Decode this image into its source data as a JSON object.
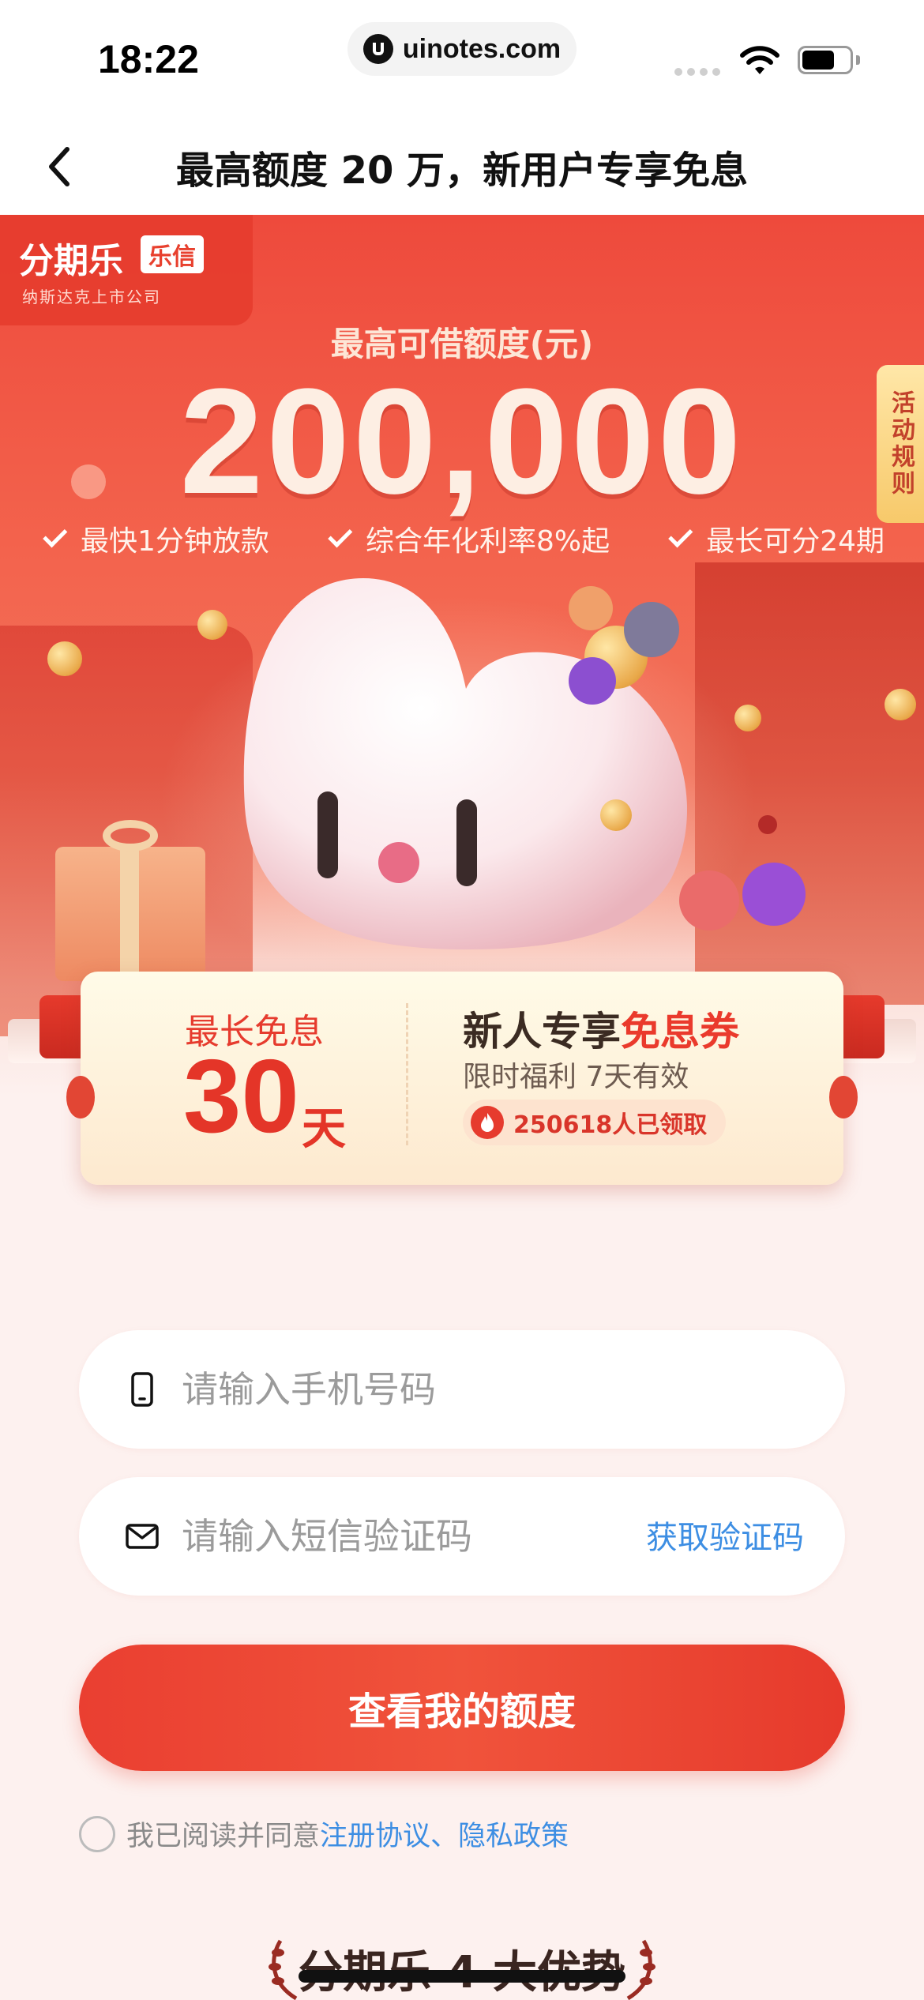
{
  "status_bar": {
    "time": "18:22",
    "url": "uinotes.com"
  },
  "nav": {
    "title": "最高额度 20 万，新用户专享免息"
  },
  "hero": {
    "brand": "分期乐",
    "brand_tag": "乐信",
    "brand_sub": "纳斯达克上市公司",
    "amount_label": "最高可借额度(元)",
    "amount": "200,000",
    "rules_tab": "活动规则",
    "features": [
      "最快1分钟放款",
      "综合年化利率8%起",
      "最长可分24期"
    ]
  },
  "coupon": {
    "left_title": "最长免息",
    "days": "30",
    "days_unit": "天",
    "right_title_prefix": "新人专享",
    "right_title_highlight": "免息券",
    "right_sub": "限时福利 7天有效",
    "badge": "250618人已领取"
  },
  "form": {
    "phone_placeholder": "请输入手机号码",
    "phone_value": "",
    "code_placeholder": "请输入短信验证码",
    "code_value": "",
    "get_code": "获取验证码",
    "submit": "查看我的额度",
    "agree_text": "我已阅读并同意",
    "agree_link": "注册协议、隐私政策"
  },
  "footer": {
    "advantages_title": "分期乐 4 大优势"
  },
  "colors": {
    "brand_red": "#e63b2e",
    "link_blue": "#3d8ee3",
    "coupon_bg": "#fffbe8"
  },
  "icons": [
    "back-chevron-icon",
    "lock-icon",
    "wifi-icon",
    "battery-icon",
    "phone-icon",
    "mail-icon",
    "check-icon",
    "flame-icon",
    "laurel-icon"
  ]
}
